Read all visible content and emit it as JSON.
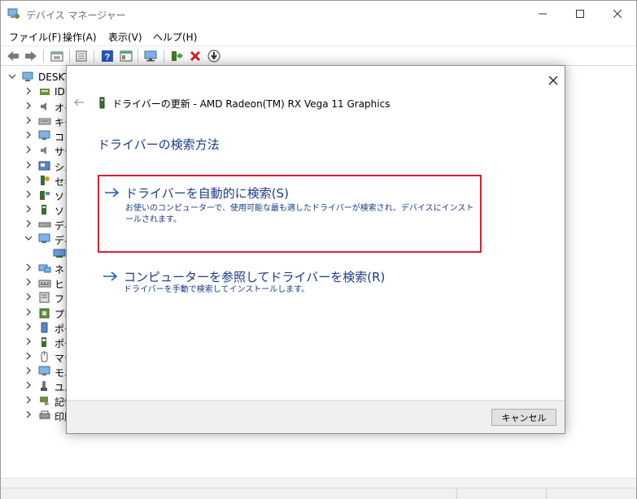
{
  "window": {
    "title": "デバイス マネージャー",
    "title_color": "#6e6e6e"
  },
  "menu": {
    "items": [
      "ファイル(F)",
      "操作(A)",
      "表示(V)",
      "ヘルプ(H)"
    ]
  },
  "toolbar": {
    "icons": [
      "back-arrow-icon",
      "forward-arrow-icon",
      "properties-icon",
      "list-view-icon",
      "help-icon",
      "details-icon",
      "scan-hardware-icon",
      "update-driver-icon",
      "uninstall-icon",
      "download-icon"
    ]
  },
  "tree": {
    "root_label": "DESKT",
    "items": [
      {
        "label": "IDE",
        "icon": "ide-controller-icon",
        "expanded": false
      },
      {
        "label": "オー",
        "icon": "audio-icon",
        "expanded": false
      },
      {
        "label": "キー",
        "icon": "keyboard-icon",
        "expanded": false
      },
      {
        "label": "コン",
        "icon": "computer-icon",
        "expanded": false
      },
      {
        "label": "サウ",
        "icon": "speaker-icon",
        "expanded": false
      },
      {
        "label": "シス",
        "icon": "system-device-icon",
        "expanded": false
      },
      {
        "label": "セキ",
        "icon": "security-key-icon",
        "expanded": false
      },
      {
        "label": "ソフ",
        "icon": "software-component-icon",
        "expanded": false
      },
      {
        "label": "ソフ",
        "icon": "software-device-icon",
        "expanded": false
      },
      {
        "label": "ディ",
        "icon": "disk-drive-icon",
        "expanded": false
      },
      {
        "label": "ディ",
        "icon": "display-adapter-icon",
        "expanded": true
      },
      {
        "label": "",
        "icon": "graphics-card-icon",
        "expanded": false,
        "child": true
      },
      {
        "label": "ネッ",
        "icon": "network-adapter-icon",
        "expanded": false
      },
      {
        "label": "ヒュ",
        "icon": "hid-icon",
        "expanded": false
      },
      {
        "label": "ファ",
        "icon": "firmware-icon",
        "expanded": false
      },
      {
        "label": "プロ",
        "icon": "processor-icon",
        "expanded": false
      },
      {
        "label": "ポー",
        "icon": "portable-device-icon",
        "expanded": false
      },
      {
        "label": "ポー",
        "icon": "port-icon",
        "expanded": false
      },
      {
        "label": "マウ",
        "icon": "mouse-icon",
        "expanded": false
      },
      {
        "label": "モニ",
        "icon": "monitor-icon",
        "expanded": false
      },
      {
        "label": "ユニ",
        "icon": "usb-icon",
        "expanded": false
      },
      {
        "label": "記憶",
        "icon": "storage-controller-icon",
        "expanded": false
      },
      {
        "label": "印刷",
        "icon": "print-queue-icon",
        "expanded": false
      }
    ]
  },
  "dialog": {
    "title": "ドライバーの更新 - AMD Radeon(TM) RX Vega 11 Graphics",
    "heading": "ドライバーの検索方法",
    "options": [
      {
        "label": "ドライバーを自動的に検索(S)",
        "description": "お使いのコンピューターで、使用可能な最も適したドライバーが検索され、デバイスにインストールされます。",
        "highlighted": true
      },
      {
        "label": "コンピューターを参照してドライバーを検索(R)",
        "description": "ドライバーを手動で検索してインストールします。",
        "highlighted": false
      }
    ],
    "cancel_label": "キャンセル"
  },
  "colors": {
    "link_blue": "#1a3a8a",
    "arrow_blue": "#1a5fb4",
    "highlight_red": "#d9212f",
    "footer_bg": "#f0f0f0"
  }
}
